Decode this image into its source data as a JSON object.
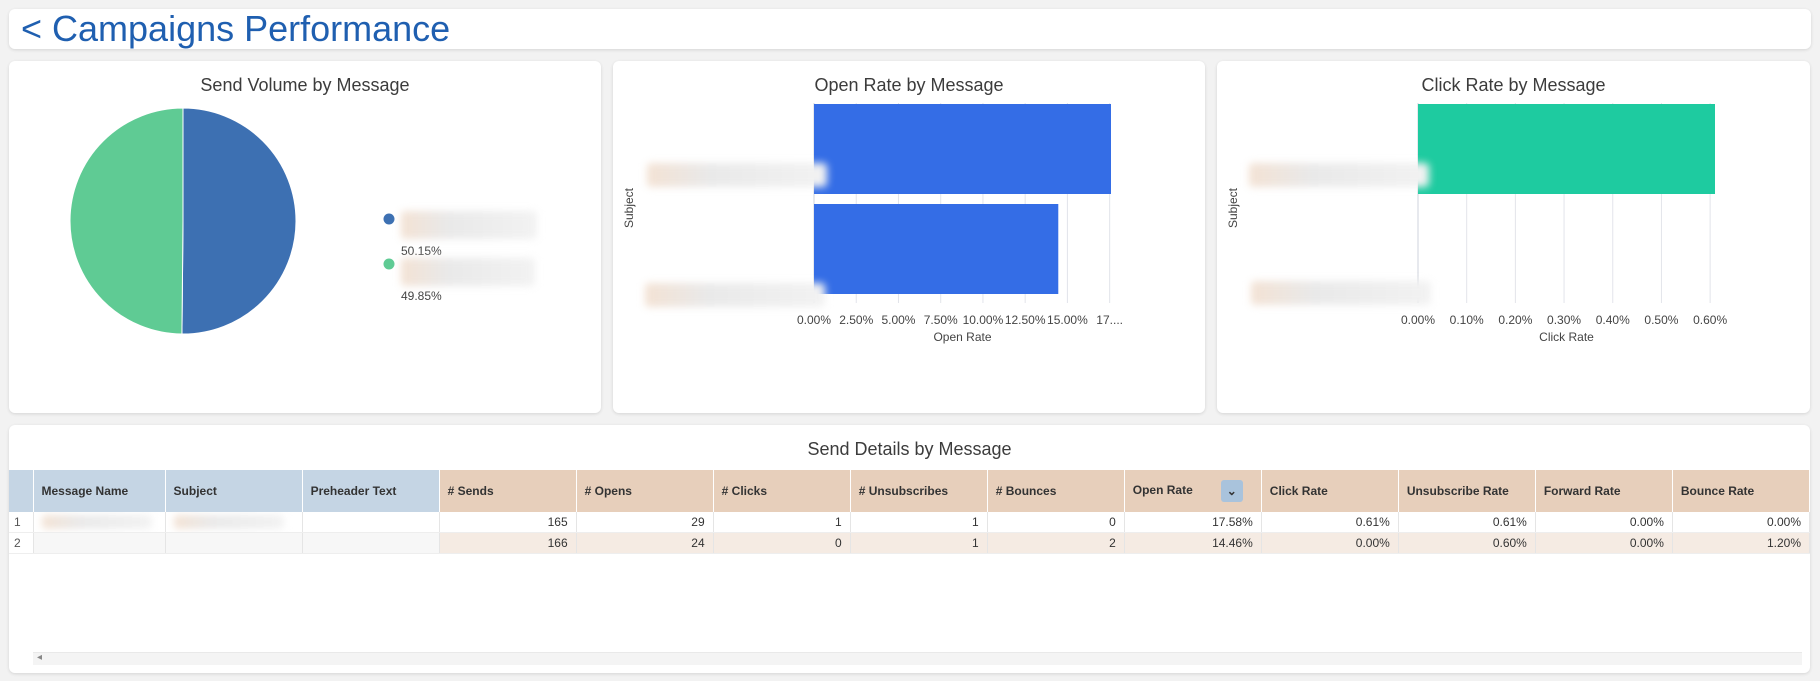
{
  "header": {
    "title": "< Campaigns Performance"
  },
  "tiles": {
    "pie": {
      "title": "Send Volume by Message"
    },
    "open": {
      "title": "Open Rate by Message"
    },
    "click": {
      "title": "Click Rate by Message"
    },
    "table": {
      "title": "Send Details by Message"
    }
  },
  "chart_data": [
    {
      "type": "pie",
      "title": "Send Volume by Message",
      "slices": [
        {
          "label": "",
          "value": 50.15,
          "display": "50.15%",
          "color": "#3d70b2"
        },
        {
          "label": "",
          "value": 49.85,
          "display": "49.85%",
          "color": "#5fcb94"
        }
      ]
    },
    {
      "type": "bar",
      "orientation": "horizontal",
      "title": "Open Rate by Message",
      "ylabel": "Subject",
      "xlabel": "Open Rate",
      "xlim": [
        0,
        17.58
      ],
      "xticks": [
        "0.00%",
        "2.50%",
        "5.00%",
        "7.50%",
        "10.00%",
        "12.50%",
        "15.00%",
        "17...."
      ],
      "categories": [
        "",
        ""
      ],
      "values": [
        17.58,
        14.46
      ],
      "color": "#346de6"
    },
    {
      "type": "bar",
      "orientation": "horizontal",
      "title": "Click Rate by Message",
      "ylabel": "Subject",
      "xlabel": "Click Rate",
      "xlim": [
        0,
        0.61
      ],
      "xticks": [
        "0.00%",
        "0.10%",
        "0.20%",
        "0.30%",
        "0.40%",
        "0.50%",
        "0.60%"
      ],
      "categories": [
        "",
        ""
      ],
      "values": [
        0.61,
        0.0
      ],
      "color": "#1ecba0"
    }
  ],
  "table": {
    "columns": [
      "Message Name",
      "Subject",
      "Preheader Text",
      "# Sends",
      "# Opens",
      "# Clicks",
      "# Unsubscribes",
      "# Bounces",
      "Open Rate",
      "Click Rate",
      "Unsubscribe Rate",
      "Forward Rate",
      "Bounce Rate"
    ],
    "rows": [
      {
        "index": "1",
        "sends": "165",
        "opens": "29",
        "clicks": "1",
        "unsubscribes": "1",
        "bounces": "0",
        "open_rate": "17.58%",
        "click_rate": "0.61%",
        "unsubscribe_rate": "0.61%",
        "forward_rate": "0.00%",
        "bounce_rate": "0.00%"
      },
      {
        "index": "2",
        "sends": "166",
        "opens": "24",
        "clicks": "0",
        "unsubscribes": "1",
        "bounces": "2",
        "open_rate": "14.46%",
        "click_rate": "0.00%",
        "unsubscribe_rate": "0.60%",
        "forward_rate": "0.00%",
        "bounce_rate": "1.20%"
      }
    ]
  },
  "icons": {
    "sort": "chevron-down-icon",
    "scroll_left": "scroll-left-arrow-icon"
  }
}
